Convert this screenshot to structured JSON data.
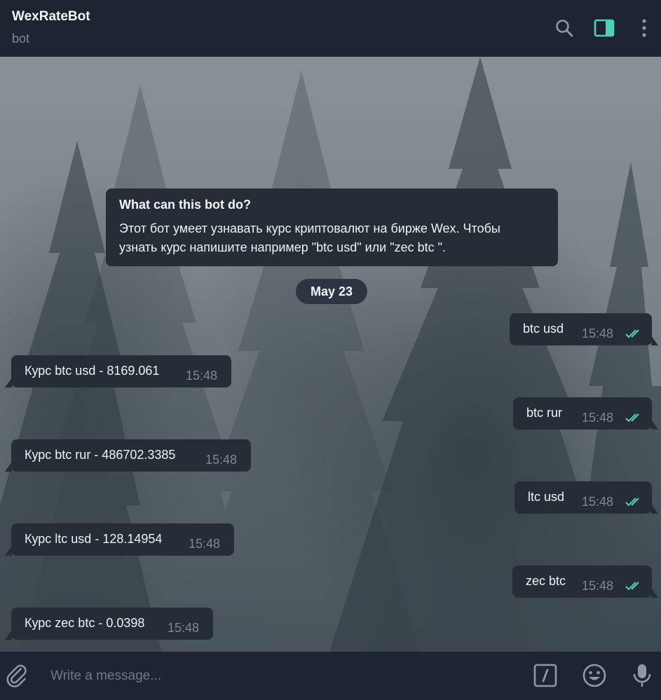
{
  "header": {
    "title": "WexRateBot",
    "status": "bot"
  },
  "intro": {
    "title": "What can this bot do?",
    "line1": "Этот бот умеет узнавать курс криптовалют на бирже Wex. Чтобы",
    "line2": "узнать курс напишите  например \"btc usd\" или \"zec btc \"."
  },
  "date_label": "May 23",
  "messages": [
    {
      "direction": "out",
      "text": "btc usd",
      "time": "15:48"
    },
    {
      "direction": "in",
      "text": "Курс btc usd - 8169.061",
      "time": "15:48"
    },
    {
      "direction": "out",
      "text": "btc rur",
      "time": "15:48"
    },
    {
      "direction": "in",
      "text": "Курс btc rur - 486702.3385",
      "time": "15:48"
    },
    {
      "direction": "out",
      "text": "ltc usd",
      "time": "15:48"
    },
    {
      "direction": "in",
      "text": "Курс ltc usd - 128.14954",
      "time": "15:48"
    },
    {
      "direction": "out",
      "text": "zec btc",
      "time": "15:48"
    },
    {
      "direction": "in",
      "text": "Курс zec btc - 0.0398",
      "time": "15:48"
    }
  ],
  "composer": {
    "placeholder": "Write a message..."
  },
  "colors": {
    "accent": "#4fd1b6",
    "bubble": "#262d36",
    "header_bg": "#1e2530",
    "timestamp": "#7c8894"
  },
  "icons": {
    "search": "search-icon",
    "panel": "sidebar-panel-icon",
    "more": "more-vertical-icon",
    "attach": "paperclip-icon",
    "commands": "slash-commands-icon",
    "emoji": "emoji-icon",
    "mic": "microphone-icon",
    "read": "double-check-icon"
  }
}
